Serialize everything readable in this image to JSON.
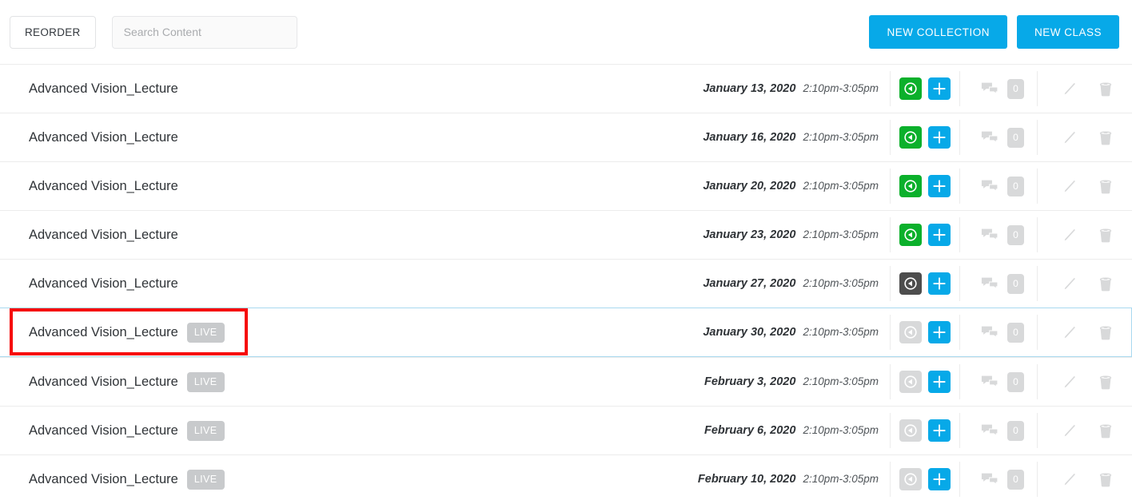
{
  "toolbar": {
    "reorder_label": "REORDER",
    "search_placeholder": "Search Content",
    "search_value": "",
    "new_collection_label": "NEW COLLECTION",
    "new_class_label": "NEW CLASS"
  },
  "colors": {
    "accent_blue": "#07a9e8",
    "record_green": "#0bb02b",
    "record_dark": "#4d4d4d",
    "record_light": "#d8d9da",
    "badge_gray": "#c8cacc",
    "selected_border": "#a8d9f0",
    "annotation_red": "#f60b0b"
  },
  "icons": {
    "record": "record-circle-icon",
    "add": "plus-icon",
    "comments": "comment-bubbles-icon",
    "edit": "pencil-icon",
    "delete": "trash-icon"
  },
  "rows": [
    {
      "title": "Advanced Vision_Lecture",
      "live": false,
      "badge": "",
      "date": "January 13, 2020",
      "time": "2:10pm-3:05pm",
      "record_state": "green",
      "comments": "0",
      "selected": false
    },
    {
      "title": "Advanced Vision_Lecture",
      "live": false,
      "badge": "",
      "date": "January 16, 2020",
      "time": "2:10pm-3:05pm",
      "record_state": "green",
      "comments": "0",
      "selected": false
    },
    {
      "title": "Advanced Vision_Lecture",
      "live": false,
      "badge": "",
      "date": "January 20, 2020",
      "time": "2:10pm-3:05pm",
      "record_state": "green",
      "comments": "0",
      "selected": false
    },
    {
      "title": "Advanced Vision_Lecture",
      "live": false,
      "badge": "",
      "date": "January 23, 2020",
      "time": "2:10pm-3:05pm",
      "record_state": "green",
      "comments": "0",
      "selected": false
    },
    {
      "title": "Advanced Vision_Lecture",
      "live": false,
      "badge": "",
      "date": "January 27, 2020",
      "time": "2:10pm-3:05pm",
      "record_state": "dark",
      "comments": "0",
      "selected": false
    },
    {
      "title": "Advanced Vision_Lecture",
      "live": true,
      "badge": "LIVE",
      "date": "January 30, 2020",
      "time": "2:10pm-3:05pm",
      "record_state": "light",
      "comments": "0",
      "selected": true
    },
    {
      "title": "Advanced Vision_Lecture",
      "live": true,
      "badge": "LIVE",
      "date": "February 3, 2020",
      "time": "2:10pm-3:05pm",
      "record_state": "light",
      "comments": "0",
      "selected": false
    },
    {
      "title": "Advanced Vision_Lecture",
      "live": true,
      "badge": "LIVE",
      "date": "February 6, 2020",
      "time": "2:10pm-3:05pm",
      "record_state": "light",
      "comments": "0",
      "selected": false
    },
    {
      "title": "Advanced Vision_Lecture",
      "live": true,
      "badge": "LIVE",
      "date": "February 10, 2020",
      "time": "2:10pm-3:05pm",
      "record_state": "light",
      "comments": "0",
      "selected": false
    }
  ]
}
